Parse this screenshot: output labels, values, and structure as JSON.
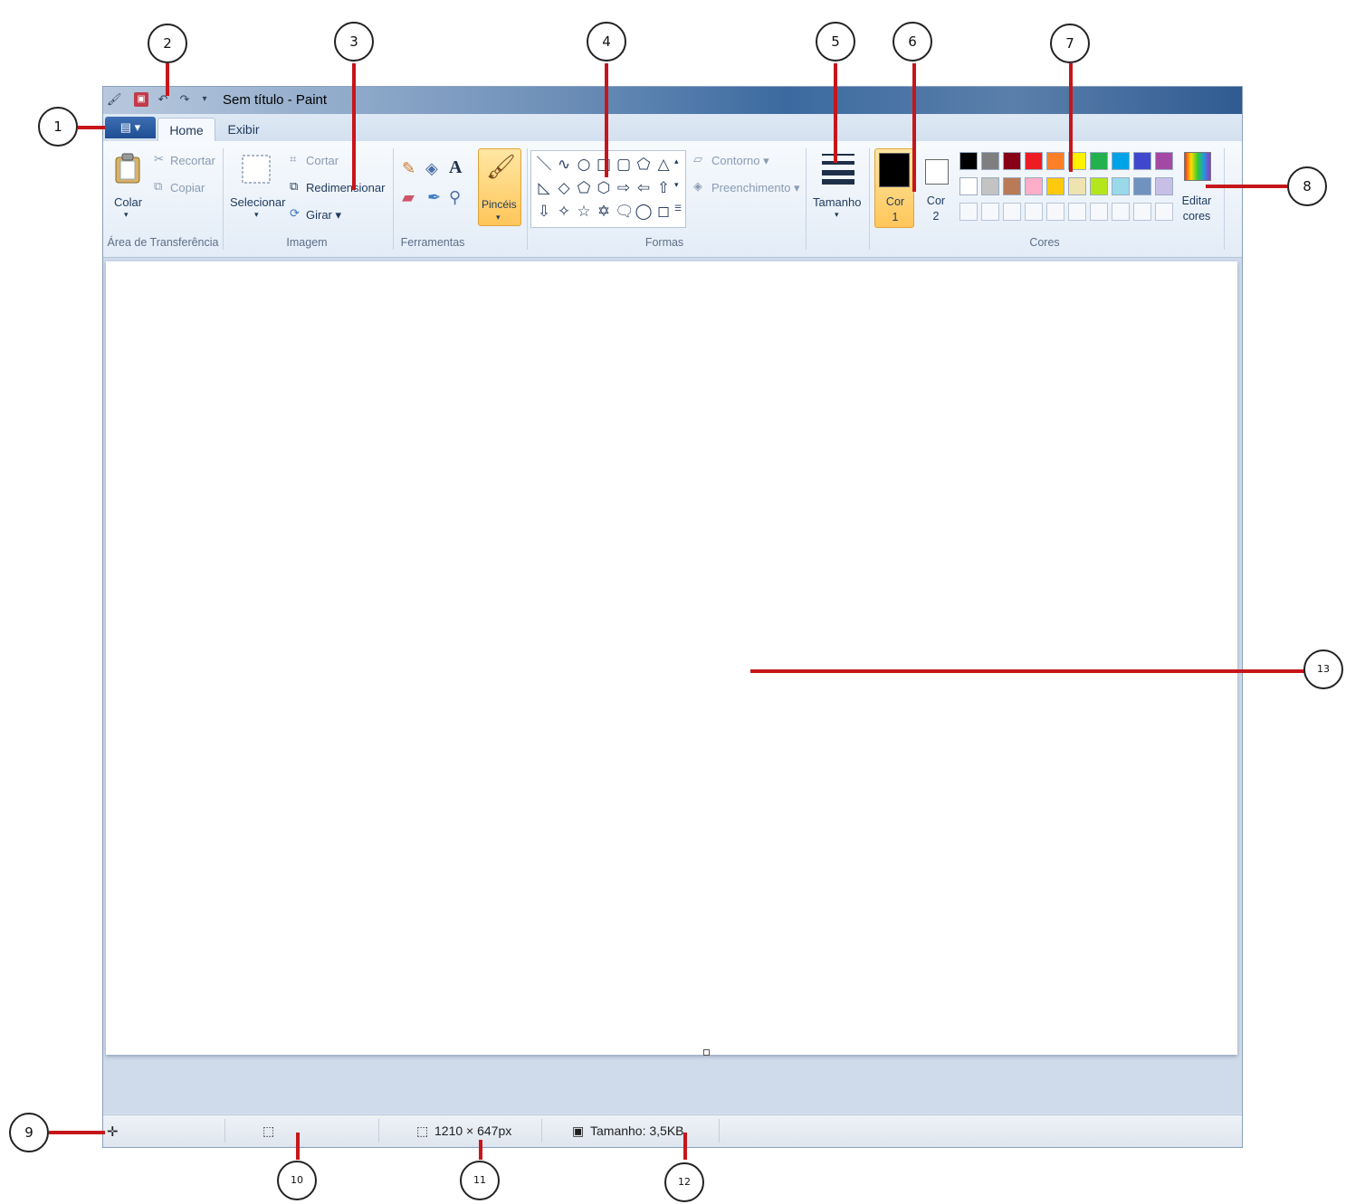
{
  "window": {
    "title": "Sem título - Paint"
  },
  "tabs": {
    "file_menu": "▤ ▾",
    "home": "Home",
    "view": "Exibir"
  },
  "clipboard": {
    "paste": "Colar",
    "cut": "Recortar",
    "copy": "Copiar",
    "group": "Área de Transferência"
  },
  "image": {
    "select": "Selecionar",
    "crop": "Cortar",
    "resize": "Redimensionar",
    "rotate": "Girar ▾",
    "group": "Imagem"
  },
  "tools": {
    "group": "Ferramentas",
    "text_tool": "A"
  },
  "brushes": {
    "label": "Pincéis"
  },
  "shapes": {
    "outline": "Contorno ▾",
    "fill": "Preenchimento ▾",
    "group": "Formas",
    "row1": [
      "＼",
      "∿",
      "○",
      "□",
      "▢",
      "⬠",
      "△"
    ],
    "row2": [
      "◺",
      "◇",
      "⬠",
      "⬡",
      "⇨",
      "⇦",
      "⇧"
    ],
    "row3": [
      "⇩",
      "✧",
      "☆",
      "✡",
      "🗨",
      "◯",
      "◻"
    ]
  },
  "size": {
    "label": "Tamanho"
  },
  "colors": {
    "color1_label": "Cor 1",
    "color2_label": "Cor 2",
    "edit_colors": "Editar cores",
    "group": "Cores",
    "color1_value": "#000000",
    "color2_value": "#ffffff",
    "palette_row1": [
      "#000000",
      "#7f7f7f",
      "#880015",
      "#ed1c24",
      "#ff7f27",
      "#fff200",
      "#22b14c",
      "#00a2e8",
      "#3f48cc",
      "#a349a4"
    ],
    "palette_row2": [
      "#ffffff",
      "#c3c3c3",
      "#b97a57",
      "#ffaec9",
      "#ffc90e",
      "#efe4b0",
      "#b5e61d",
      "#99d9ea",
      "#7092be",
      "#c8bfe7"
    ]
  },
  "status": {
    "cursor_icon": "✛",
    "selection_icon": "⬚",
    "dimensions": "1210 × 647px",
    "file_size": "Tamanho: 3,5KB"
  },
  "callouts": [
    "1",
    "2",
    "3",
    "4",
    "5",
    "6",
    "7",
    "8",
    "9",
    "10",
    "11",
    "12",
    "13"
  ]
}
